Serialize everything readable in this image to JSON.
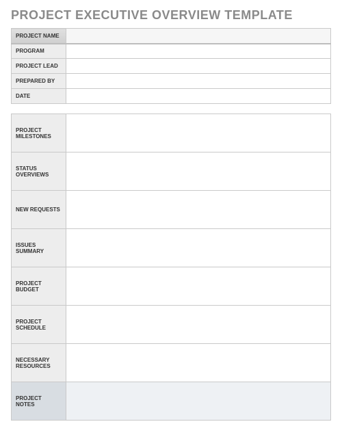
{
  "title": "PROJECT EXECUTIVE OVERVIEW TEMPLATE",
  "header": {
    "rows": [
      {
        "label": "PROJECT NAME",
        "value": ""
      },
      {
        "label": "PROGRAM",
        "value": ""
      },
      {
        "label": "PROJECT LEAD",
        "value": ""
      },
      {
        "label": "PREPARED BY",
        "value": ""
      },
      {
        "label": "DATE",
        "value": ""
      }
    ]
  },
  "sections": {
    "rows": [
      {
        "label": "PROJECT MILESTONES",
        "value": ""
      },
      {
        "label": "STATUS OVERVIEWS",
        "value": ""
      },
      {
        "label": "NEW REQUESTS",
        "value": ""
      },
      {
        "label": "ISSUES SUMMARY",
        "value": ""
      },
      {
        "label": "PROJECT BUDGET",
        "value": ""
      },
      {
        "label": "PROJECT SCHEDULE",
        "value": ""
      },
      {
        "label": "NECESSARY RESOURCES",
        "value": ""
      },
      {
        "label": "PROJECT NOTES",
        "value": ""
      }
    ]
  }
}
